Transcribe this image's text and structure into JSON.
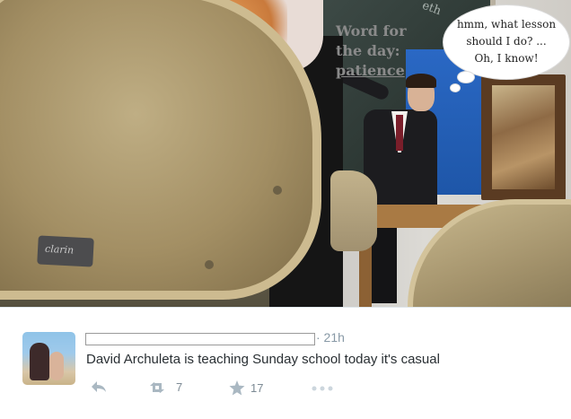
{
  "image_overlay": {
    "word_note": {
      "line1": "Word for",
      "line2": "the day:",
      "line3": "patience"
    },
    "thought_bubble": {
      "line1": "hmm, what lesson",
      "line2": "should I do? ...",
      "line3": "Oh, I know!"
    },
    "board_scribble": "eth",
    "chair_plate": "clarin"
  },
  "tweet": {
    "timestamp": "· 21h",
    "text": "David Archuleta is teaching Sunday school today it's casual",
    "actions": {
      "reply_icon": "reply-icon",
      "retweet_icon": "retweet-icon",
      "retweet_count": "7",
      "favorite_icon": "star-icon",
      "favorite_count": "17",
      "more_icon": "more-icon"
    }
  },
  "colors": {
    "muted": "#aab8c2",
    "text": "#292f33",
    "meta": "#8899a6"
  }
}
